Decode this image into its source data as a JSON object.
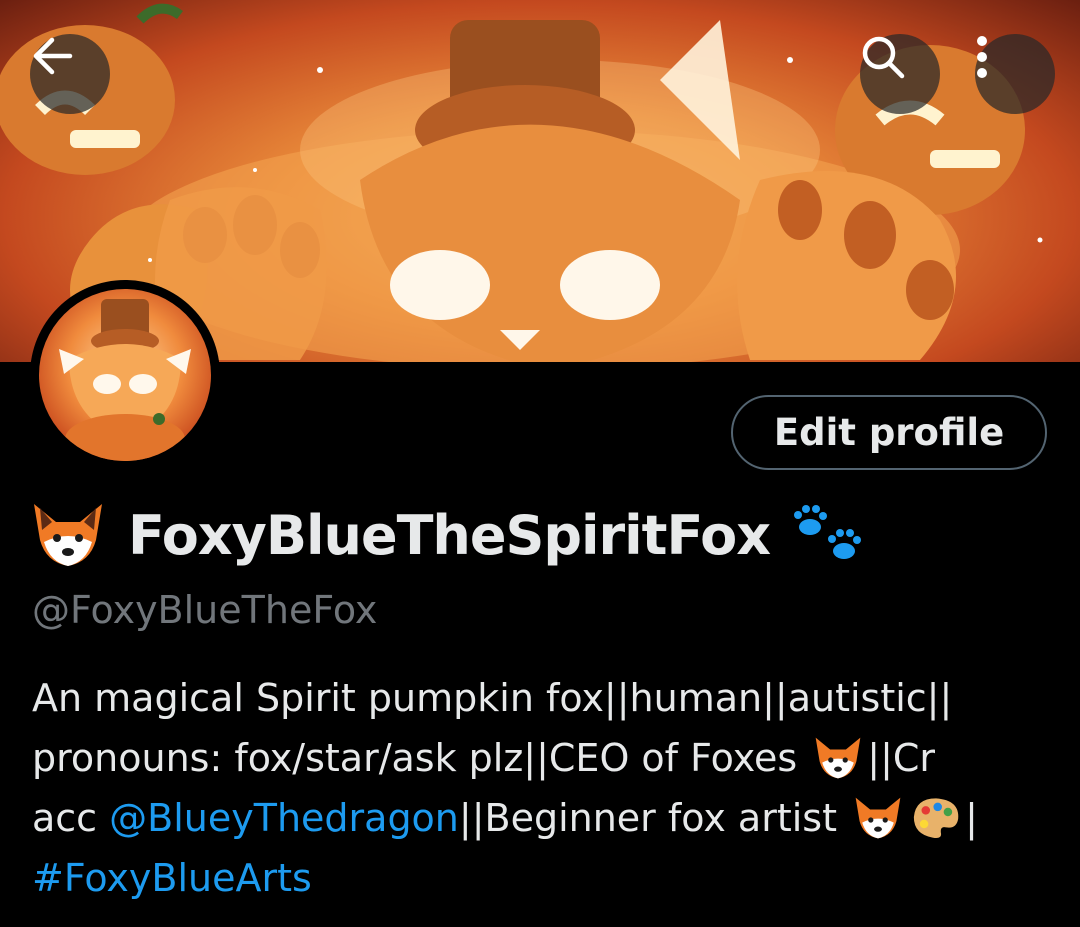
{
  "header": {
    "back_icon": "arrow-left-icon",
    "search_icon": "search-icon",
    "more_icon": "more-vertical-icon"
  },
  "profile": {
    "edit_button_label": "Edit profile",
    "display_name": "FoxyBlueTheSpiritFox",
    "handle": "@FoxyBlueTheFox",
    "name_prefix_emoji": "fox-face-emoji",
    "name_suffix_emoji": "paw-prints-emoji"
  },
  "bio": {
    "line1": "An magical Spirit pumpkin fox||human||autistic||",
    "line2_a": "pronouns: fox/star/ask plz||CEO of Foxes ",
    "line2_b": "||Cr",
    "line3_a": "acc ",
    "line3_link": "@BlueyThedragon",
    "line3_b": "||Beginner fox artist ",
    "line3_c": "|",
    "line4_hashtag": "#FoxyBlueArts"
  },
  "colors": {
    "background": "#000000",
    "text_primary": "#e7e9ea",
    "text_secondary": "#71767b",
    "link": "#1d9bf0",
    "button_border": "#536471"
  }
}
